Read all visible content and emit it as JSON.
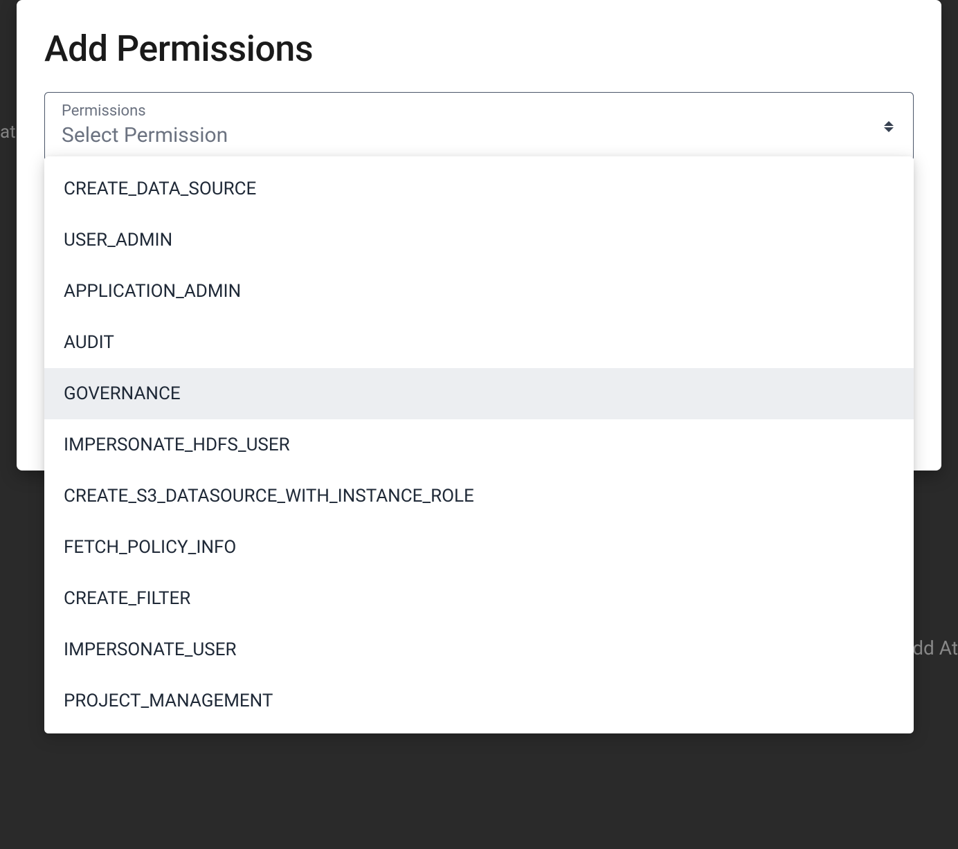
{
  "background": {
    "left_fragment": "at",
    "right_fragment": "Add At"
  },
  "modal": {
    "title": "Add Permissions",
    "select": {
      "label": "Permissions",
      "placeholder": "Select Permission"
    },
    "options": [
      {
        "label": "CREATE_DATA_SOURCE",
        "highlighted": false
      },
      {
        "label": "USER_ADMIN",
        "highlighted": false
      },
      {
        "label": "APPLICATION_ADMIN",
        "highlighted": false
      },
      {
        "label": "AUDIT",
        "highlighted": false
      },
      {
        "label": "GOVERNANCE",
        "highlighted": true
      },
      {
        "label": "IMPERSONATE_HDFS_USER",
        "highlighted": false
      },
      {
        "label": "CREATE_S3_DATASOURCE_WITH_INSTANCE_ROLE",
        "highlighted": false
      },
      {
        "label": "FETCH_POLICY_INFO",
        "highlighted": false
      },
      {
        "label": "CREATE_FILTER",
        "highlighted": false
      },
      {
        "label": "IMPERSONATE_USER",
        "highlighted": false
      },
      {
        "label": "PROJECT_MANAGEMENT",
        "highlighted": false
      }
    ]
  }
}
